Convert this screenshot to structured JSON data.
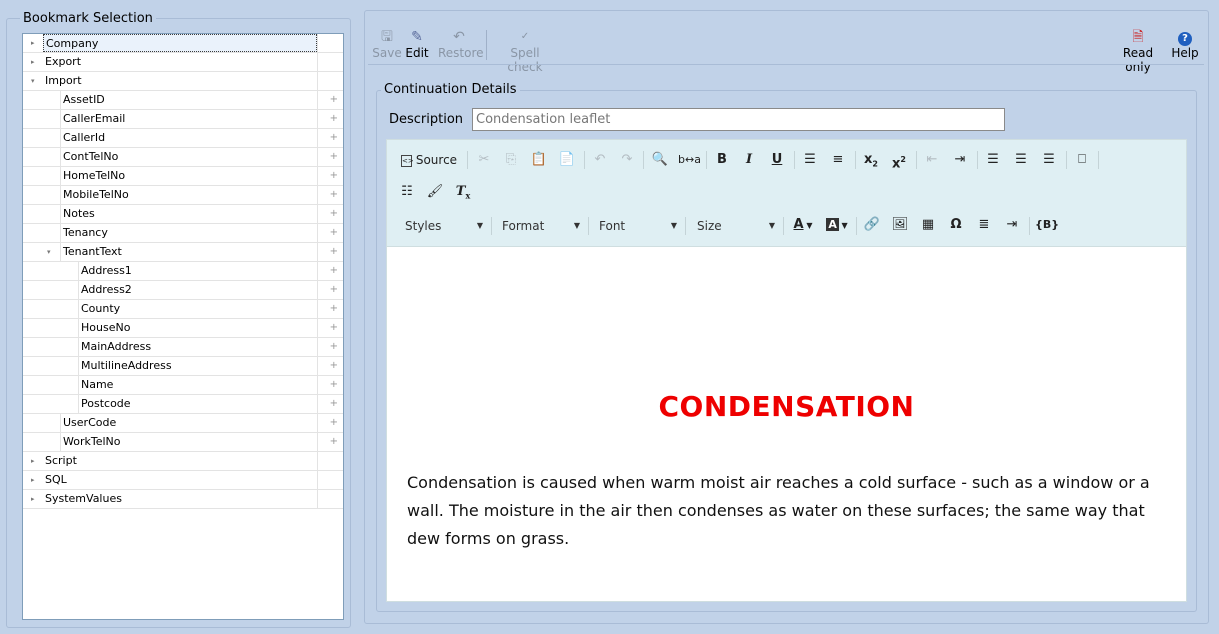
{
  "bookmarks": {
    "legend": "Bookmark Selection",
    "tree": [
      {
        "label": "Company",
        "level": 0,
        "expander": "▸",
        "selected": true
      },
      {
        "label": "Export",
        "level": 0,
        "expander": "▸"
      },
      {
        "label": "Import",
        "level": 0,
        "expander": "▾"
      },
      {
        "label": "AssetID",
        "level": 1,
        "plus": "+"
      },
      {
        "label": "CallerEmail",
        "level": 1,
        "plus": "+"
      },
      {
        "label": "CallerId",
        "level": 1,
        "plus": "+"
      },
      {
        "label": "ContTelNo",
        "level": 1,
        "plus": "+"
      },
      {
        "label": "HomeTelNo",
        "level": 1,
        "plus": "+"
      },
      {
        "label": "MobileTelNo",
        "level": 1,
        "plus": "+"
      },
      {
        "label": "Notes",
        "level": 1,
        "plus": "+"
      },
      {
        "label": "Tenancy",
        "level": 1,
        "plus": "+"
      },
      {
        "label": "TenantText",
        "level": 1,
        "expander": "▾",
        "plus": "+"
      },
      {
        "label": "Address1",
        "level": 2,
        "plus": "+"
      },
      {
        "label": "Address2",
        "level": 2,
        "plus": "+"
      },
      {
        "label": "County",
        "level": 2,
        "plus": "+"
      },
      {
        "label": "HouseNo",
        "level": 2,
        "plus": "+"
      },
      {
        "label": "MainAddress",
        "level": 2,
        "plus": "+"
      },
      {
        "label": "MultilineAddress",
        "level": 2,
        "plus": "+"
      },
      {
        "label": "Name",
        "level": 2,
        "plus": "+"
      },
      {
        "label": "Postcode",
        "level": 2,
        "plus": "+"
      },
      {
        "label": "UserCode",
        "level": 1,
        "plus": "+"
      },
      {
        "label": "WorkTelNo",
        "level": 1,
        "plus": "+"
      },
      {
        "label": "Script",
        "level": 0,
        "expander": "▸"
      },
      {
        "label": "SQL",
        "level": 0,
        "expander": "▸"
      },
      {
        "label": "SystemValues",
        "level": 0,
        "expander": "▸"
      }
    ]
  },
  "toolbar": {
    "save": "Save",
    "edit": "Edit",
    "restore": "Restore",
    "spell_check": "Spell check",
    "read_only": "Read only",
    "help": "Help"
  },
  "details": {
    "legend": "Continuation Details",
    "description_label": "Description",
    "description_value": "Condensation leaflet"
  },
  "editor": {
    "source_label": "Source",
    "combos": {
      "styles": "Styles",
      "format": "Format",
      "font": "Font",
      "size": "Size"
    },
    "heading": "CONDENSATION",
    "heading_color": "#ee0000",
    "paragraph": "Condensation is caused when warm moist air reaches a cold surface - such as a window or a wall.  The moisture in the air then condenses as water on these surfaces; the same way that dew forms on grass."
  }
}
